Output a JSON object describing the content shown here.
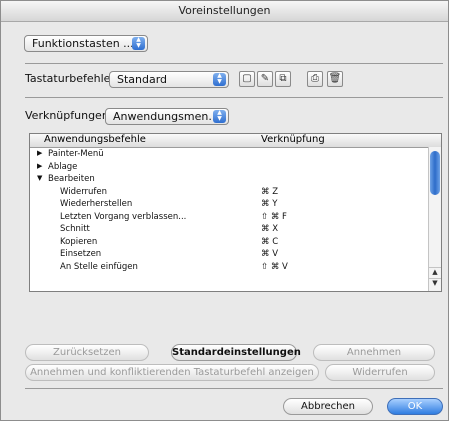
{
  "window": {
    "title": "Voreinstellungen"
  },
  "category_popup": {
    "value": "Funktionstasten ..."
  },
  "shortcuts": {
    "label": "Tastaturbefehle:",
    "value": "Standard"
  },
  "toolbar": {
    "icons": [
      "new-document-icon",
      "edit-document-icon",
      "duplicate-icon",
      "save-icon",
      "delete-icon"
    ]
  },
  "links": {
    "label": "Verknüpfungen:",
    "value": "Anwendungsmen..."
  },
  "table": {
    "col_command": "Anwendungsbefehle",
    "col_shortcut": "Verknüpfung",
    "rows": [
      {
        "name": "Painter-Menü",
        "shortcut": "",
        "expander": "▶"
      },
      {
        "name": "Ablage",
        "shortcut": "",
        "expander": "▶"
      },
      {
        "name": "Bearbeiten",
        "shortcut": "",
        "expander": "▼"
      },
      {
        "name": "Widerrufen",
        "shortcut": "⌘ Z",
        "expander": ""
      },
      {
        "name": "Wiederherstellen",
        "shortcut": "⌘ Y",
        "expander": ""
      },
      {
        "name": "Letzten Vorgang verblassen...",
        "shortcut": "⇧ ⌘ F",
        "expander": ""
      },
      {
        "name": "Schnitt",
        "shortcut": "⌘ X",
        "expander": ""
      },
      {
        "name": "Kopieren",
        "shortcut": "⌘ C",
        "expander": ""
      },
      {
        "name": "Einsetzen",
        "shortcut": "⌘ V",
        "expander": ""
      },
      {
        "name": "An Stelle einfügen",
        "shortcut": "⇧ ⌘ V",
        "expander": ""
      }
    ]
  },
  "buttons": {
    "reset": "Zurücksetzen",
    "defaults": "Standardeinstellungen",
    "accept": "Annehmen",
    "accept_conflict": "Annehmen und konfliktierenden Tastaturbefehl anzeigen",
    "undo": "Widerrufen",
    "cancel": "Abbrechen",
    "ok": "OK"
  }
}
